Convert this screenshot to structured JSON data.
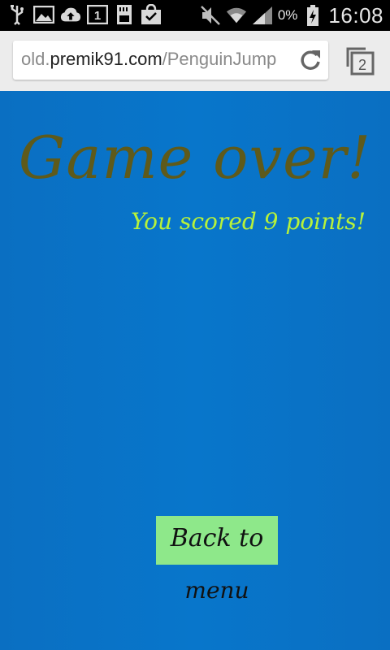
{
  "status_bar": {
    "icons": [
      "usb-icon",
      "image-icon",
      "cloud-upload-icon",
      "sim-1-icon",
      "sd-card-icon",
      "shopping-bag-icon",
      "muted-icon",
      "wifi-icon",
      "signal-icon",
      "battery-charging-icon"
    ],
    "battery_percent": "0%",
    "time": "16:08"
  },
  "browser": {
    "url_prefix": "old.",
    "url_domain": "premik91.com",
    "url_path": "/PenguinJump",
    "tab_count": "2"
  },
  "game": {
    "title": "Game over!",
    "score_text": "You scored 9 points!",
    "back_label_line1": "Back to",
    "back_label_line2": "menu",
    "colors": {
      "background": "#0a71c4",
      "title": "#5e5a1b",
      "score": "#b7f23a",
      "button": "#8ee88a"
    }
  }
}
